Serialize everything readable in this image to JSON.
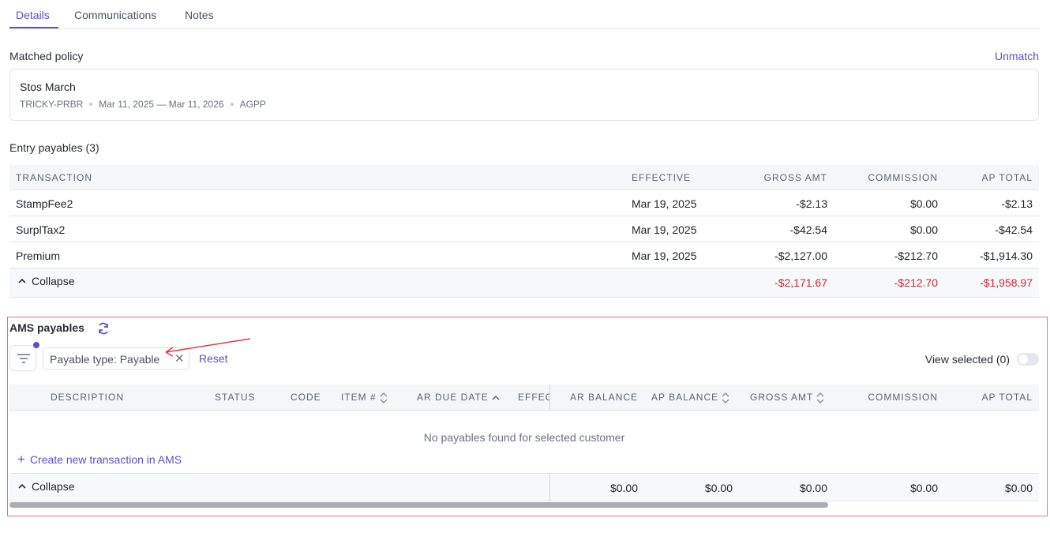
{
  "tabs": [
    {
      "label": "Details",
      "active": true
    },
    {
      "label": "Communications",
      "active": false
    },
    {
      "label": "Notes",
      "active": false
    }
  ],
  "matched_policy": {
    "title": "Matched policy",
    "action": "Unmatch",
    "name": "Stos March",
    "code": "TRICKY-PRBR",
    "dates": "Mar 11, 2025 — Mar 11, 2026",
    "carrier": "AGPP"
  },
  "entry_payables": {
    "title": "Entry payables (3)",
    "columns": [
      "TRANSACTION",
      "EFFECTIVE",
      "GROSS AMT",
      "COMMISSION",
      "AP TOTAL"
    ],
    "rows": [
      {
        "transaction": "StampFee2",
        "effective": "Mar 19, 2025",
        "gross": "-$2.13",
        "commission": "$0.00",
        "ap_total": "-$2.13"
      },
      {
        "transaction": "SurplTax2",
        "effective": "Mar 19, 2025",
        "gross": "-$42.54",
        "commission": "$0.00",
        "ap_total": "-$42.54"
      },
      {
        "transaction": "Premium",
        "effective": "Mar 19, 2025",
        "gross": "-$2,127.00",
        "commission": "-$212.70",
        "ap_total": "-$1,914.30"
      }
    ],
    "collapse_label": "Collapse",
    "totals": {
      "gross": "-$2,171.67",
      "commission": "-$212.70",
      "ap_total": "-$1,958.97"
    }
  },
  "ams_payables": {
    "title": "AMS payables",
    "filter_chip": "Payable type: Payable",
    "reset": "Reset",
    "view_selected": "View selected (0)",
    "columns": {
      "description": "DESCRIPTION",
      "status": "STATUS",
      "code": "CODE",
      "item": "ITEM #",
      "ar_due_date": "AR DUE DATE",
      "effective": "EFFEC",
      "ar_balance": "AR BALANCE",
      "ap_balance": "AP BALANCE",
      "gross_amt": "GROSS AMT",
      "commission": "COMMISSION",
      "ap_total": "AP TOTAL"
    },
    "empty_message": "No payables found for selected customer",
    "create_link": "Create new transaction in AMS",
    "collapse_label": "Collapse",
    "totals": {
      "ar_balance": "$0.00",
      "ap_balance": "$0.00",
      "gross_amt": "$0.00",
      "commission": "$0.00",
      "ap_total": "$0.00"
    }
  },
  "colors": {
    "accent": "#5a4fcf",
    "negative": "#d0263a",
    "highlight_border": "#e6747e"
  }
}
